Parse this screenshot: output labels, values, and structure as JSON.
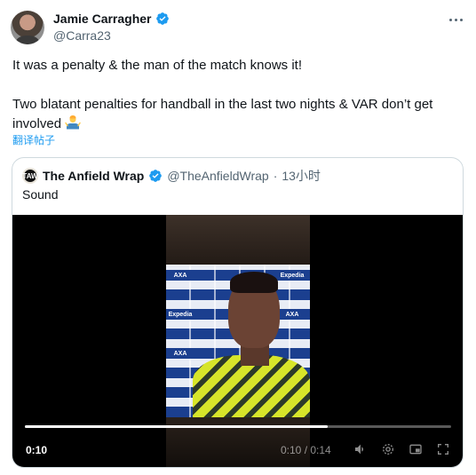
{
  "author": {
    "name": "Jamie Carragher",
    "handle": "@Carra23"
  },
  "tweet": {
    "text": "It was a penalty & the man of the match knows it!\n\nTwo blatant penalties for handball in the last two nights & VAR don’t get involved "
  },
  "translate_label": "翻译帖子",
  "quoted": {
    "logo_text": "TAW",
    "name": "The Anfield Wrap",
    "handle": "@TheAnfieldWrap",
    "separator": "·",
    "time": "13小时",
    "text": "Sound"
  },
  "video": {
    "elapsed": "0:10",
    "time_display": "0:10 / 0:14",
    "progress": 0.71,
    "board_logos": [
      "AXA",
      "Expedia",
      "AXA",
      "Expedia",
      "AXA"
    ]
  },
  "icons": {
    "verified": "verified-badge-icon",
    "more": "more-options-icon",
    "emoji": "man-shrugging-emoji",
    "volume": "volume-icon",
    "settings": "settings-icon",
    "pip": "picture-in-picture-icon",
    "fullscreen": "fullscreen-icon"
  },
  "colors": {
    "accent": "#1d9bf0",
    "text": "#0f1419",
    "muted": "#536471",
    "border": "#cfd9de"
  }
}
